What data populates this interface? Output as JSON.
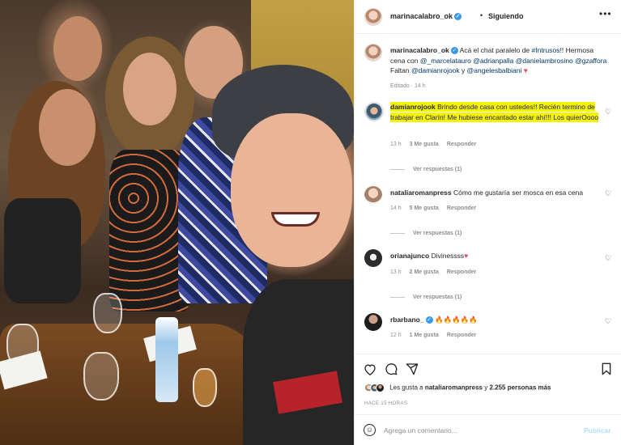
{
  "post": {
    "username": "marinacalabro_ok",
    "follow_separator": "•",
    "follow_status": "Siguiendo",
    "more_icon": "more-horizontal-icon",
    "caption": {
      "username": "marinacalabro_ok",
      "text_1": "Acá el chat paralelo de",
      "hashtag": "#Intrusos",
      "text_2": "!! Hermosa cena con",
      "mentions_1": "@_marcelatauro @adrianpalla @danielambrosino @gzaffora",
      "text_3": "Faltan",
      "mentions_2": "@damianrojook",
      "text_4": "y",
      "mentions_3": "@angelesbalbiani",
      "heart": "♥",
      "edited": "Editado · 14 h"
    }
  },
  "comments": [
    {
      "username": "damianrojook",
      "text": "Brindo desde casa con ustedes!! Recién termino de trabajar en Clarín! Me hubiese encantado estar ahí!!! Los quierOooo",
      "time": "13 h",
      "likes": "3 Me gusta",
      "reply": "Responder",
      "view_replies": "Ver respuestas (1)"
    },
    {
      "username": "nataliaromanpress",
      "text": "Cómo me gustaría ser mosca en esa cena",
      "time": "14 h",
      "likes": "5 Me gusta",
      "reply": "Responder",
      "view_replies": "Ver respuestas (1)"
    },
    {
      "username": "orianajunco",
      "text": "Divinessss",
      "heart": "♥",
      "time": "13 h",
      "likes": "2 Me gusta",
      "reply": "Responder",
      "view_replies": "Ver respuestas (1)"
    },
    {
      "username": "rbarbano_",
      "text": "🔥🔥🔥🔥🔥",
      "time": "12 h",
      "likes": "1 Me gusta",
      "reply": "Responder"
    }
  ],
  "actions": {
    "like_icon": "heart-icon",
    "comment_icon": "comment-icon",
    "share_icon": "share-icon",
    "save_icon": "bookmark-icon"
  },
  "likes_summary": {
    "prefix": "Les gusta a",
    "user": "nataliaromanpress",
    "middle": "y",
    "count": "2.255 personas más"
  },
  "time_ago": "HACE 15 HORAS",
  "comment_box": {
    "placeholder": "Agrega un comentario...",
    "post_label": "Publicar"
  },
  "colors": {
    "highlight": "#f4f10b",
    "link": "#00376b",
    "verified": "#3897f0",
    "publish_disabled": "#b2dffc",
    "heart": "#ed4956"
  }
}
